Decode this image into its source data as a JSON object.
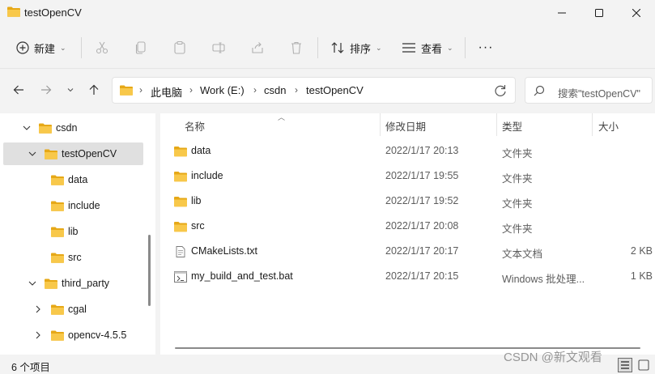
{
  "window": {
    "title": "testOpenCV"
  },
  "commandbar": {
    "new_label": "新建",
    "sort_label": "排序",
    "view_label": "查看",
    "more_label": "···"
  },
  "address": {
    "crumbs": [
      "此电脑",
      "Work (E:)",
      "csdn",
      "testOpenCV"
    ]
  },
  "search": {
    "placeholder": "搜索\"testOpenCV\""
  },
  "tree": {
    "items": [
      {
        "label": "csdn",
        "expanded": true
      },
      {
        "label": "testOpenCV",
        "expanded": true,
        "selected": true
      },
      {
        "label": "data"
      },
      {
        "label": "include"
      },
      {
        "label": "lib"
      },
      {
        "label": "src"
      },
      {
        "label": "third_party",
        "expanded": true
      },
      {
        "label": "cgal",
        "expanded": false
      },
      {
        "label": "opencv-4.5.5",
        "expanded": false
      }
    ]
  },
  "columns": {
    "name": "名称",
    "date": "修改日期",
    "type": "类型",
    "size": "大小"
  },
  "files": [
    {
      "name": "data",
      "date": "2022/1/17 20:13",
      "type": "文件夹",
      "size": "",
      "icon": "folder-icon"
    },
    {
      "name": "include",
      "date": "2022/1/17 19:55",
      "type": "文件夹",
      "size": "",
      "icon": "folder-icon"
    },
    {
      "name": "lib",
      "date": "2022/1/17 19:52",
      "type": "文件夹",
      "size": "",
      "icon": "folder-icon"
    },
    {
      "name": "src",
      "date": "2022/1/17 20:08",
      "type": "文件夹",
      "size": "",
      "icon": "folder-icon"
    },
    {
      "name": "CMakeLists.txt",
      "date": "2022/1/17 20:17",
      "type": "文本文档",
      "size": "2 KB",
      "icon": "text-file-icon"
    },
    {
      "name": "my_build_and_test.bat",
      "date": "2022/1/17 20:15",
      "type": "Windows 批处理...",
      "size": "1 KB",
      "icon": "batch-file-icon"
    }
  ],
  "status": {
    "item_count": "6 个项目"
  },
  "watermark": "CSDN @新文观看",
  "colors": {
    "folder": "#f8c84a",
    "selection": "#e0e0e0",
    "background": "#f3f3f3"
  }
}
